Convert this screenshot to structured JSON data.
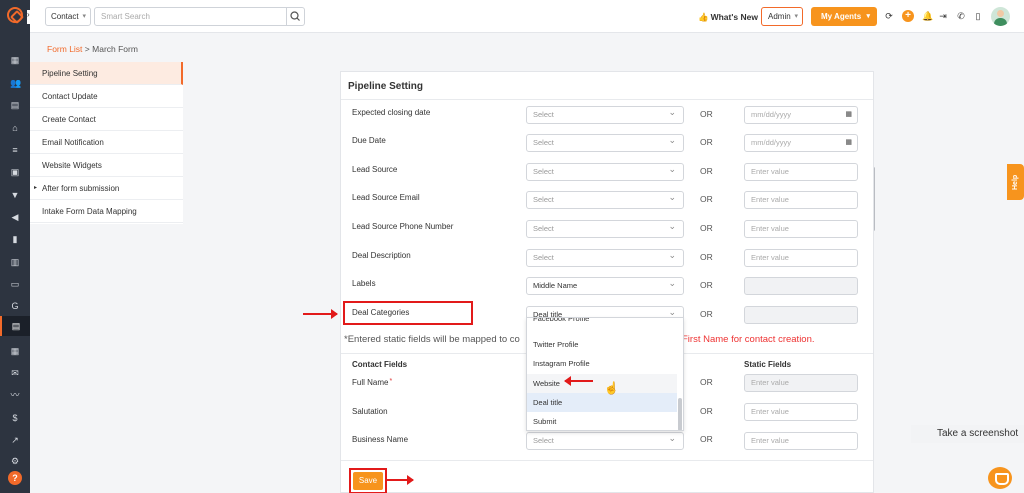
{
  "topbar": {
    "search_type": "Contact",
    "search_placeholder": "Smart Search",
    "whats_new": "What's New",
    "admin_label": "Admin",
    "agents_label": "My Agents"
  },
  "breadcrumb": {
    "parent": "Form List",
    "separator": ">",
    "current": "March Form"
  },
  "left_menu": [
    "Pipeline Setting",
    "Contact Update",
    "Create Contact",
    "Email Notification",
    "Website Widgets",
    "After form submission",
    "Intake Form Data Mapping"
  ],
  "card": {
    "title": "Pipeline Setting",
    "or_label": "OR",
    "rows": [
      {
        "label": "Expected closing date",
        "select": "Select",
        "value": "mm/dd/yyyy"
      },
      {
        "label": "Due Date",
        "select": "Select",
        "value": "mm/dd/yyyy"
      },
      {
        "label": "Lead Source",
        "select": "Select",
        "value": "Enter value"
      },
      {
        "label": "Lead Source Email",
        "select": "Select",
        "value": "Enter value"
      },
      {
        "label": "Lead Source Phone Number",
        "select": "Select",
        "value": "Enter value"
      },
      {
        "label": "Deal Description",
        "select": "Select",
        "value": "Enter value"
      },
      {
        "label": "Labels",
        "select": "Middle Name",
        "value": ""
      },
      {
        "label": "Deal Categories",
        "select": "Deal title",
        "value": ""
      }
    ],
    "note": "*Entered static fields will be mapped to co",
    "note_red": "First Name for contact creation.",
    "contact_fields_header": "Contact Fields",
    "static_fields_header": "Static Fields",
    "contact_rows": [
      {
        "label": "Full Name",
        "required": "*",
        "value": "Enter value"
      },
      {
        "label": "Salutation",
        "value": "Enter value"
      },
      {
        "label": "Business Name",
        "select": "Select",
        "value": "Enter value"
      }
    ],
    "save_label": "Save"
  },
  "dropdown": {
    "items": [
      "Facebook Profile",
      "Twitter Profile",
      "Instagram Profile",
      "Website",
      "Deal title",
      "Submit"
    ]
  },
  "widgets": {
    "help_tab": "Help",
    "screenshot_label": "Take a screenshot"
  },
  "colors": {
    "accent": "#f7941d",
    "annotation": "#e21a1a",
    "rail": "#2d3440"
  }
}
